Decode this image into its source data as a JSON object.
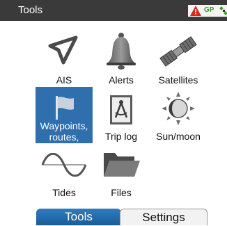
{
  "window": {
    "title": "Tools"
  },
  "status": {
    "gp_label": "GP"
  },
  "tiles": [
    {
      "label": "AIS",
      "icon": "ais-triangle-icon"
    },
    {
      "label": "Alerts",
      "icon": "bell-icon"
    },
    {
      "label": "Satellites",
      "icon": "satellite-icon"
    },
    {
      "label": "Waypoints,\nroutes, tracks",
      "icon": "flag-icon"
    },
    {
      "label": "Trip log",
      "icon": "compass-book-icon"
    },
    {
      "label": "Sun/moon",
      "icon": "sun-moon-icon"
    },
    {
      "label": "Tides",
      "icon": "sine-wave-icon"
    },
    {
      "label": "Files",
      "icon": "folder-icon"
    }
  ],
  "tabs": {
    "tools": "Tools",
    "settings": "Settings"
  },
  "colors": {
    "selected": "#2f6fae",
    "warning": "#d9261c",
    "gp": "#3f9a2a"
  }
}
